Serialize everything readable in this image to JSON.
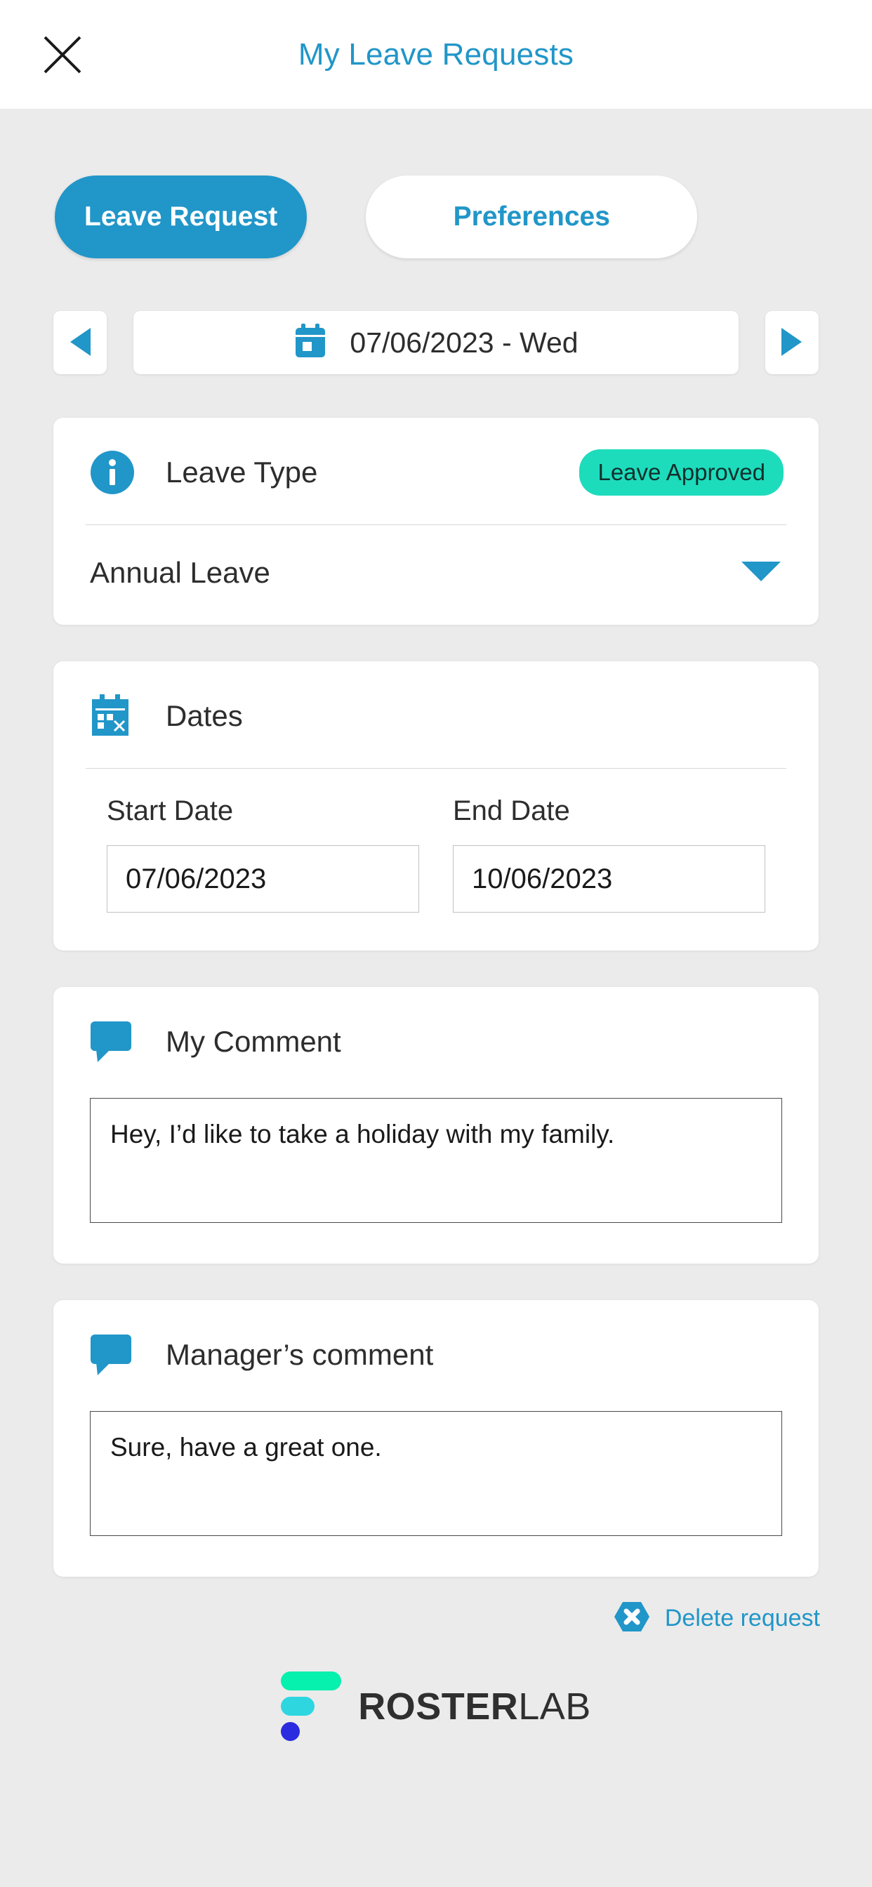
{
  "header": {
    "title": "My Leave Requests",
    "close_icon": "close-icon"
  },
  "tabs": [
    {
      "label": "Leave Request",
      "active": true
    },
    {
      "label": "Preferences",
      "active": false
    }
  ],
  "date_nav": {
    "prev_icon": "triangle-left-icon",
    "next_icon": "triangle-right-icon",
    "calendar_icon": "calendar-icon",
    "value": "07/06/2023 - Wed"
  },
  "leave_type": {
    "icon": "info-icon",
    "title": "Leave Type",
    "status_badge": "Leave Approved",
    "selected": "Annual Leave",
    "dropdown_icon": "chevron-down-icon"
  },
  "dates": {
    "icon": "calendar-cancel-icon",
    "title": "Dates",
    "start_label": "Start Date",
    "start_value": "07/06/2023",
    "end_label": "End Date",
    "end_value": "10/06/2023"
  },
  "my_comment": {
    "icon": "speech-bubble-icon",
    "title": "My Comment",
    "value": "Hey, I’d like to take a holiday with my family."
  },
  "manager_comment": {
    "icon": "speech-bubble-icon",
    "title": "Manager’s comment",
    "value": "Sure, have a great one."
  },
  "delete": {
    "icon": "delete-x-icon",
    "label": "Delete request"
  },
  "logo": {
    "primary": "ROSTER",
    "secondary": "LAB"
  },
  "colors": {
    "accent_blue": "#2196c8",
    "badge_green": "#1ddcbc",
    "page_bg": "#ebebeb",
    "card_bg": "#ffffff"
  }
}
